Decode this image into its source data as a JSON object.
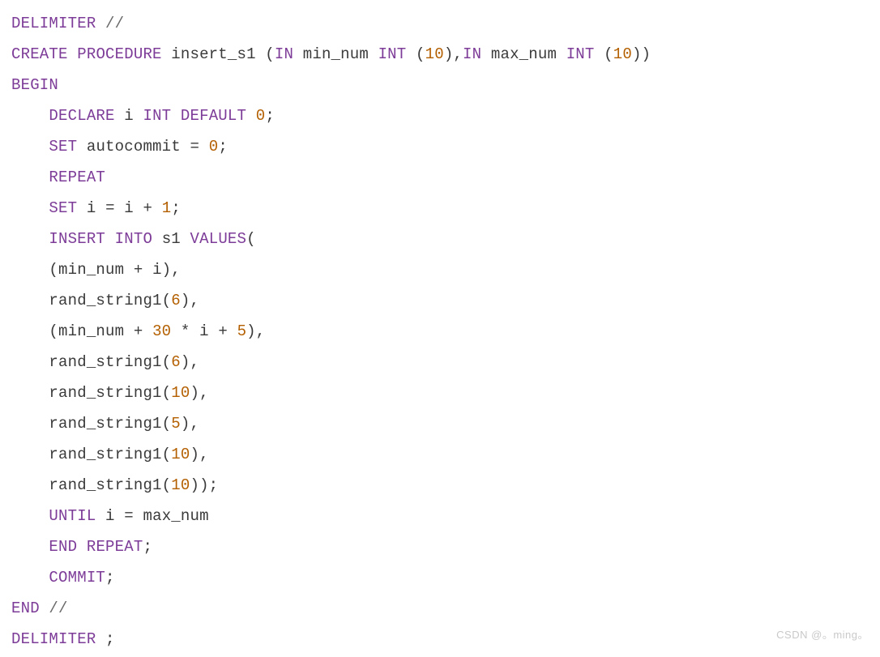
{
  "code": {
    "l01": {
      "t1": "DELIMITER",
      "t2": "//"
    },
    "l02": {
      "t1": "CREATE",
      "t2": "PROCEDURE",
      "t3": "insert_s1",
      "t4": "(",
      "t5": "IN",
      "t6": "min_num",
      "t7": "INT",
      "t8": "(",
      "t9": "10",
      "t10": "),",
      "t11": "IN",
      "t12": "max_num",
      "t13": "INT",
      "t14": "(",
      "t15": "10",
      "t16": "))"
    },
    "l03": {
      "t1": "BEGIN"
    },
    "l04": {
      "t1": "DECLARE",
      "t2": "i",
      "t3": "INT",
      "t4": "DEFAULT",
      "t5": "0",
      "t6": ";"
    },
    "l05": {
      "t1": "SET",
      "t2": "autocommit",
      "t3": "=",
      "t4": "0",
      "t5": ";"
    },
    "l06": {
      "t1": "REPEAT"
    },
    "l07": {
      "t1": "SET",
      "t2": "i",
      "t3": "=",
      "t4": "i",
      "t5": "+",
      "t6": "1",
      "t7": ";"
    },
    "l08": {
      "t1": "INSERT",
      "t2": "INTO",
      "t3": "s1",
      "t4": "VALUES",
      "t5": "("
    },
    "l09": {
      "t1": "(min_num",
      "t2": "+",
      "t3": "i),"
    },
    "l10": {
      "t1": "rand_string1(",
      "t2": "6",
      "t3": "),"
    },
    "l11": {
      "t1": "(min_num",
      "t2": "+",
      "t3": "30",
      "t4": "*",
      "t5": "i",
      "t6": "+",
      "t7": "5",
      "t8": "),"
    },
    "l12": {
      "t1": "rand_string1(",
      "t2": "6",
      "t3": "),"
    },
    "l13": {
      "t1": "rand_string1(",
      "t2": "10",
      "t3": "),"
    },
    "l14": {
      "t1": "rand_string1(",
      "t2": "5",
      "t3": "),"
    },
    "l15": {
      "t1": "rand_string1(",
      "t2": "10",
      "t3": "),"
    },
    "l16": {
      "t1": "rand_string1(",
      "t2": "10",
      "t3": "));"
    },
    "l17": {
      "t1": "UNTIL",
      "t2": "i",
      "t3": "=",
      "t4": "max_num"
    },
    "l18": {
      "t1": "END",
      "t2": "REPEAT",
      "t3": ";"
    },
    "l19": {
      "t1": "COMMIT",
      "t2": ";"
    },
    "l20": {
      "t1": "END",
      "t2": "//"
    },
    "l21": {
      "t1": "DELIMITER",
      "t2": ";"
    }
  },
  "watermark": "CSDN @。ming。"
}
